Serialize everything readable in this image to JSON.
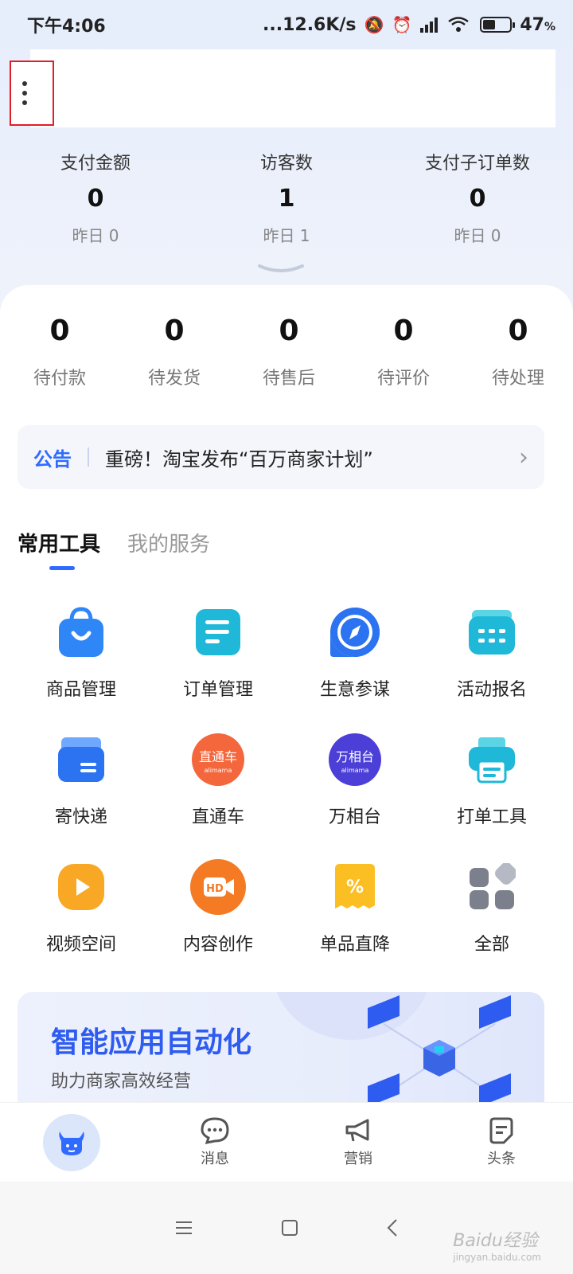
{
  "status_bar": {
    "time": "下午4:06",
    "network_speed": "...12.6K/s",
    "battery": "47",
    "battery_unit": "%",
    "battery_level": 0.47
  },
  "stats": [
    {
      "label": "支付金额",
      "value": "0",
      "yesterday": "昨日 0"
    },
    {
      "label": "访客数",
      "value": "1",
      "yesterday": "昨日 1"
    },
    {
      "label": "支付子订单数",
      "value": "0",
      "yesterday": "昨日 0"
    }
  ],
  "orders": [
    {
      "count": "0",
      "label": "待付款"
    },
    {
      "count": "0",
      "label": "待发货"
    },
    {
      "count": "0",
      "label": "待售后"
    },
    {
      "count": "0",
      "label": "待评价"
    },
    {
      "count": "0",
      "label": "待处理"
    }
  ],
  "notice": {
    "tag": "公告",
    "text": "重磅！淘宝发布“百万商家计划”"
  },
  "tabs": [
    {
      "label": "常用工具",
      "active": true
    },
    {
      "label": "我的服务",
      "active": false
    }
  ],
  "tools": [
    {
      "label": "商品管理",
      "icon": "shopping-bag-icon"
    },
    {
      "label": "订单管理",
      "icon": "order-list-icon"
    },
    {
      "label": "生意参谋",
      "icon": "compass-icon"
    },
    {
      "label": "活动报名",
      "icon": "calendar-icon"
    },
    {
      "label": "寄快递",
      "icon": "package-box-icon"
    },
    {
      "label": "直通车",
      "icon": "zhitongche-logo-icon",
      "icon_text": "直通车",
      "icon_sub": "alimama"
    },
    {
      "label": "万相台",
      "icon": "wanxiangtai-logo-icon",
      "icon_text": "万相台",
      "icon_sub": "alimama"
    },
    {
      "label": "打单工具",
      "icon": "printer-icon"
    },
    {
      "label": "视频空间",
      "icon": "video-play-icon"
    },
    {
      "label": "内容创作",
      "icon": "hd-camera-icon",
      "icon_text": "HD"
    },
    {
      "label": "单品直降",
      "icon": "discount-ticket-icon"
    },
    {
      "label": "全部",
      "icon": "all-apps-icon"
    }
  ],
  "banner": {
    "title": "智能应用自动化",
    "subtitle": "助力商家高效经营"
  },
  "nav": [
    {
      "label": "",
      "icon": "niu-home-icon"
    },
    {
      "label": "消息",
      "icon": "message-bubble-icon"
    },
    {
      "label": "营销",
      "icon": "megaphone-icon"
    },
    {
      "label": "头条",
      "icon": "headline-doc-icon"
    }
  ],
  "watermark": {
    "text": "Baidu经验",
    "sub": "jingyan.baidu.com"
  },
  "colors": {
    "accent": "#2f6bff",
    "highlight_box": "#e11d25"
  }
}
